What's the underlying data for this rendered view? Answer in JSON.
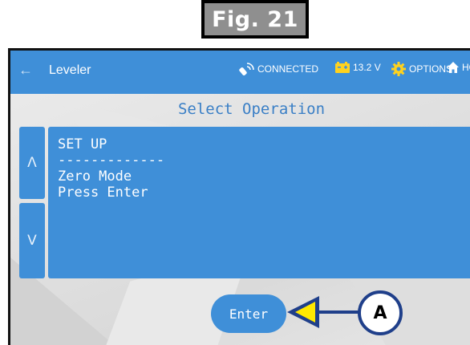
{
  "figure": {
    "label": "Fig. 21"
  },
  "topbar": {
    "back_icon": "back-arrow-icon",
    "title": "Leveler",
    "connection_status": "CONNECTED",
    "battery_voltage": "13.2 V",
    "options_label": "OPTIONS",
    "home_label": "HOM",
    "colors": {
      "bar": "#3f8fd8"
    }
  },
  "main": {
    "title": "Select Operation",
    "up_arrow": "Λ",
    "down_arrow": "V",
    "display_lines": [
      "SET UP",
      "-------------",
      "Zero Mode",
      "Press Enter"
    ],
    "enter_label": "Enter"
  },
  "callout": {
    "label": "A",
    "color": "#1f3f8a",
    "arrow_fill": "#ffe800"
  }
}
